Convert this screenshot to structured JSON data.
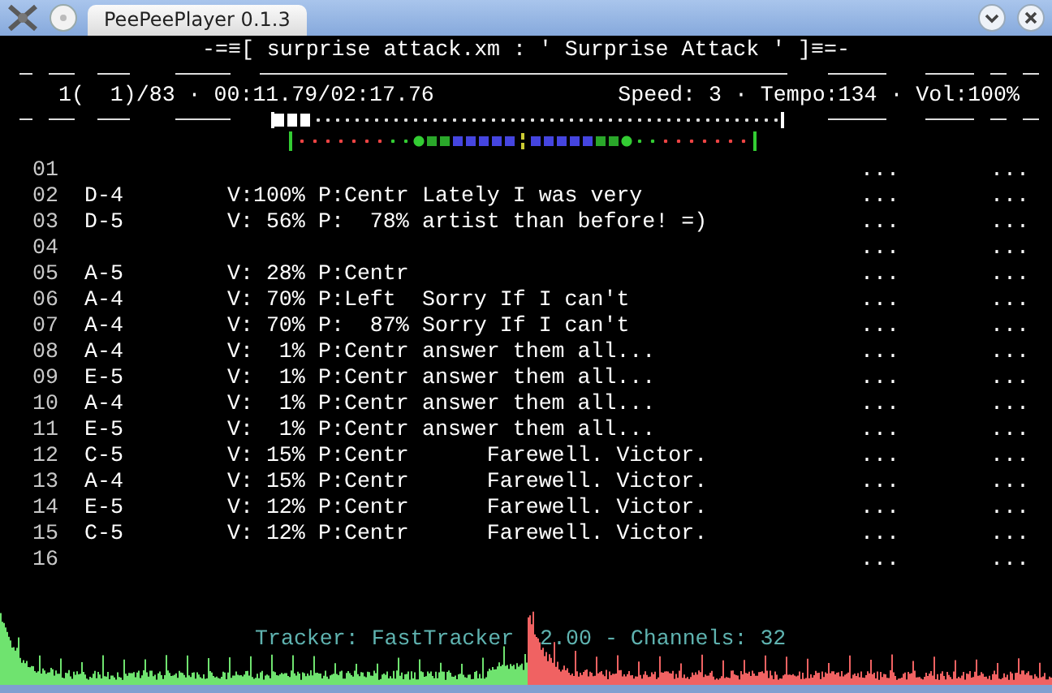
{
  "window": {
    "title": "PeePeePlayer 0.1.3"
  },
  "header": {
    "title": "-=≡[ surprise attack.xm : ' Surprise Attack ' ]≡=-",
    "position": "1(  1)/83 · 00:11.79/02:17.76",
    "settings": "Speed: 3 · Tempo:134 · Vol:100%"
  },
  "progress": {
    "level": 0.07
  },
  "rows": [
    {
      "number": "01",
      "column_6": "...",
      "column_7": "..."
    },
    {
      "number": "02",
      "note": "D-4",
      "volume": "V:100%",
      "pan": "P:Centr",
      "text": "Lately I was very",
      "column_6": "...",
      "column_7": "..."
    },
    {
      "number": "03",
      "note": "D-5",
      "volume": "V: 56%",
      "pan": "P:  78%",
      "text": "artist than before! =)",
      "column_6": "...",
      "column_7": "..."
    },
    {
      "number": "04",
      "column_6": "...",
      "column_7": "..."
    },
    {
      "number": "05",
      "note": "A-5",
      "volume": "V: 28%",
      "pan": "P:Centr",
      "column_6": "...",
      "column_7": "..."
    },
    {
      "number": "06",
      "note": "A-4",
      "volume": "V: 70%",
      "pan": "P:Left",
      "text": "Sorry If I can't",
      "column_6": "...",
      "column_7": "..."
    },
    {
      "number": "07",
      "note": "A-4",
      "volume": "V: 70%",
      "pan": "P:  87%",
      "text": "Sorry If I can't",
      "column_6": "...",
      "column_7": "..."
    },
    {
      "number": "08",
      "note": "A-4",
      "volume": "V:  1%",
      "pan": "P:Centr",
      "text": "answer them all...",
      "column_6": "...",
      "column_7": "..."
    },
    {
      "number": "09",
      "note": "E-5",
      "volume": "V:  1%",
      "pan": "P:Centr",
      "text": "answer them all...",
      "column_6": "...",
      "column_7": "..."
    },
    {
      "number": "10",
      "note": "A-4",
      "volume": "V:  1%",
      "pan": "P:Centr",
      "text": "answer them all...",
      "column_6": "...",
      "column_7": "..."
    },
    {
      "number": "11",
      "note": "E-5",
      "volume": "V:  1%",
      "pan": "P:Centr",
      "text": "answer them all...",
      "column_6": "...",
      "column_7": "..."
    },
    {
      "number": "12",
      "note": "C-5",
      "volume": "V: 15%",
      "pan": "P:Centr",
      "text": "     Farewell. Victor.",
      "column_6": "...",
      "column_7": "..."
    },
    {
      "number": "13",
      "note": "A-4",
      "volume": "V: 15%",
      "pan": "P:Centr",
      "text": "     Farewell. Victor.",
      "column_6": "...",
      "column_7": "..."
    },
    {
      "number": "14",
      "note": "E-5",
      "volume": "V: 12%",
      "pan": "P:Centr",
      "text": "     Farewell. Victor.",
      "column_6": "...",
      "column_7": "..."
    },
    {
      "number": "15",
      "note": "C-5",
      "volume": "V: 12%",
      "pan": "P:Centr",
      "text": "     Farewell. Victor.",
      "column_6": "...",
      "column_7": "..."
    },
    {
      "number": "16",
      "column_6": "...",
      "column_7": "..."
    }
  ],
  "status": "Tracker: FastTracker  2.00 - Channels: 32"
}
